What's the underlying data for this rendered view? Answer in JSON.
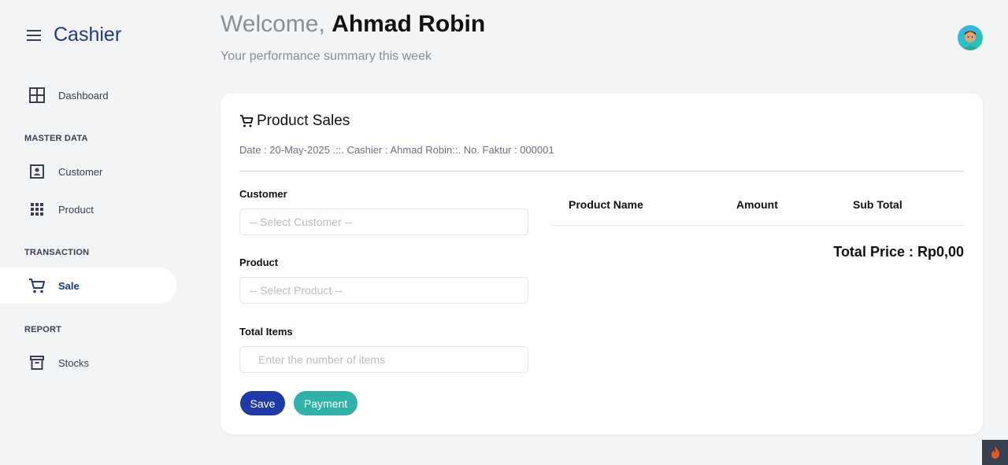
{
  "app": {
    "title": "Cashier"
  },
  "header": {
    "greeting": "Welcome, ",
    "user_name": "Ahmad Robin",
    "subtitle": "Your performance summary this week"
  },
  "sidebar": {
    "items": [
      {
        "label": "Dashboard",
        "icon": "grid-icon"
      },
      {
        "section": "MASTER DATA"
      },
      {
        "label": "Customer",
        "icon": "contact-card-icon"
      },
      {
        "label": "Product",
        "icon": "apps-grid-icon"
      },
      {
        "section": "TRANSACTION"
      },
      {
        "label": "Sale",
        "icon": "cart-icon",
        "active": true
      },
      {
        "section": "REPORT"
      },
      {
        "label": "Stocks",
        "icon": "archive-box-icon"
      }
    ]
  },
  "sale": {
    "title": "Product Sales",
    "meta": "Date : 20-May-2025 .::. Cashier : Ahmad Robin::. No. Faktur : 000001",
    "customer_label": "Customer",
    "customer_placeholder": "-- Select Customer --",
    "product_label": "Product",
    "product_placeholder": "-- Select Product --",
    "items_label": "Total Items",
    "items_placeholder": "Enter the number of items",
    "save_label": "Save",
    "payment_label": "Payment",
    "table_headers": [
      "Product Name",
      "Amount",
      "Sub Total"
    ],
    "total_text": "Total Price : Rp0,00"
  },
  "colors": {
    "accent": "#1e3a8a",
    "save": "#1e3aa8",
    "payment": "#2fb3a9"
  }
}
